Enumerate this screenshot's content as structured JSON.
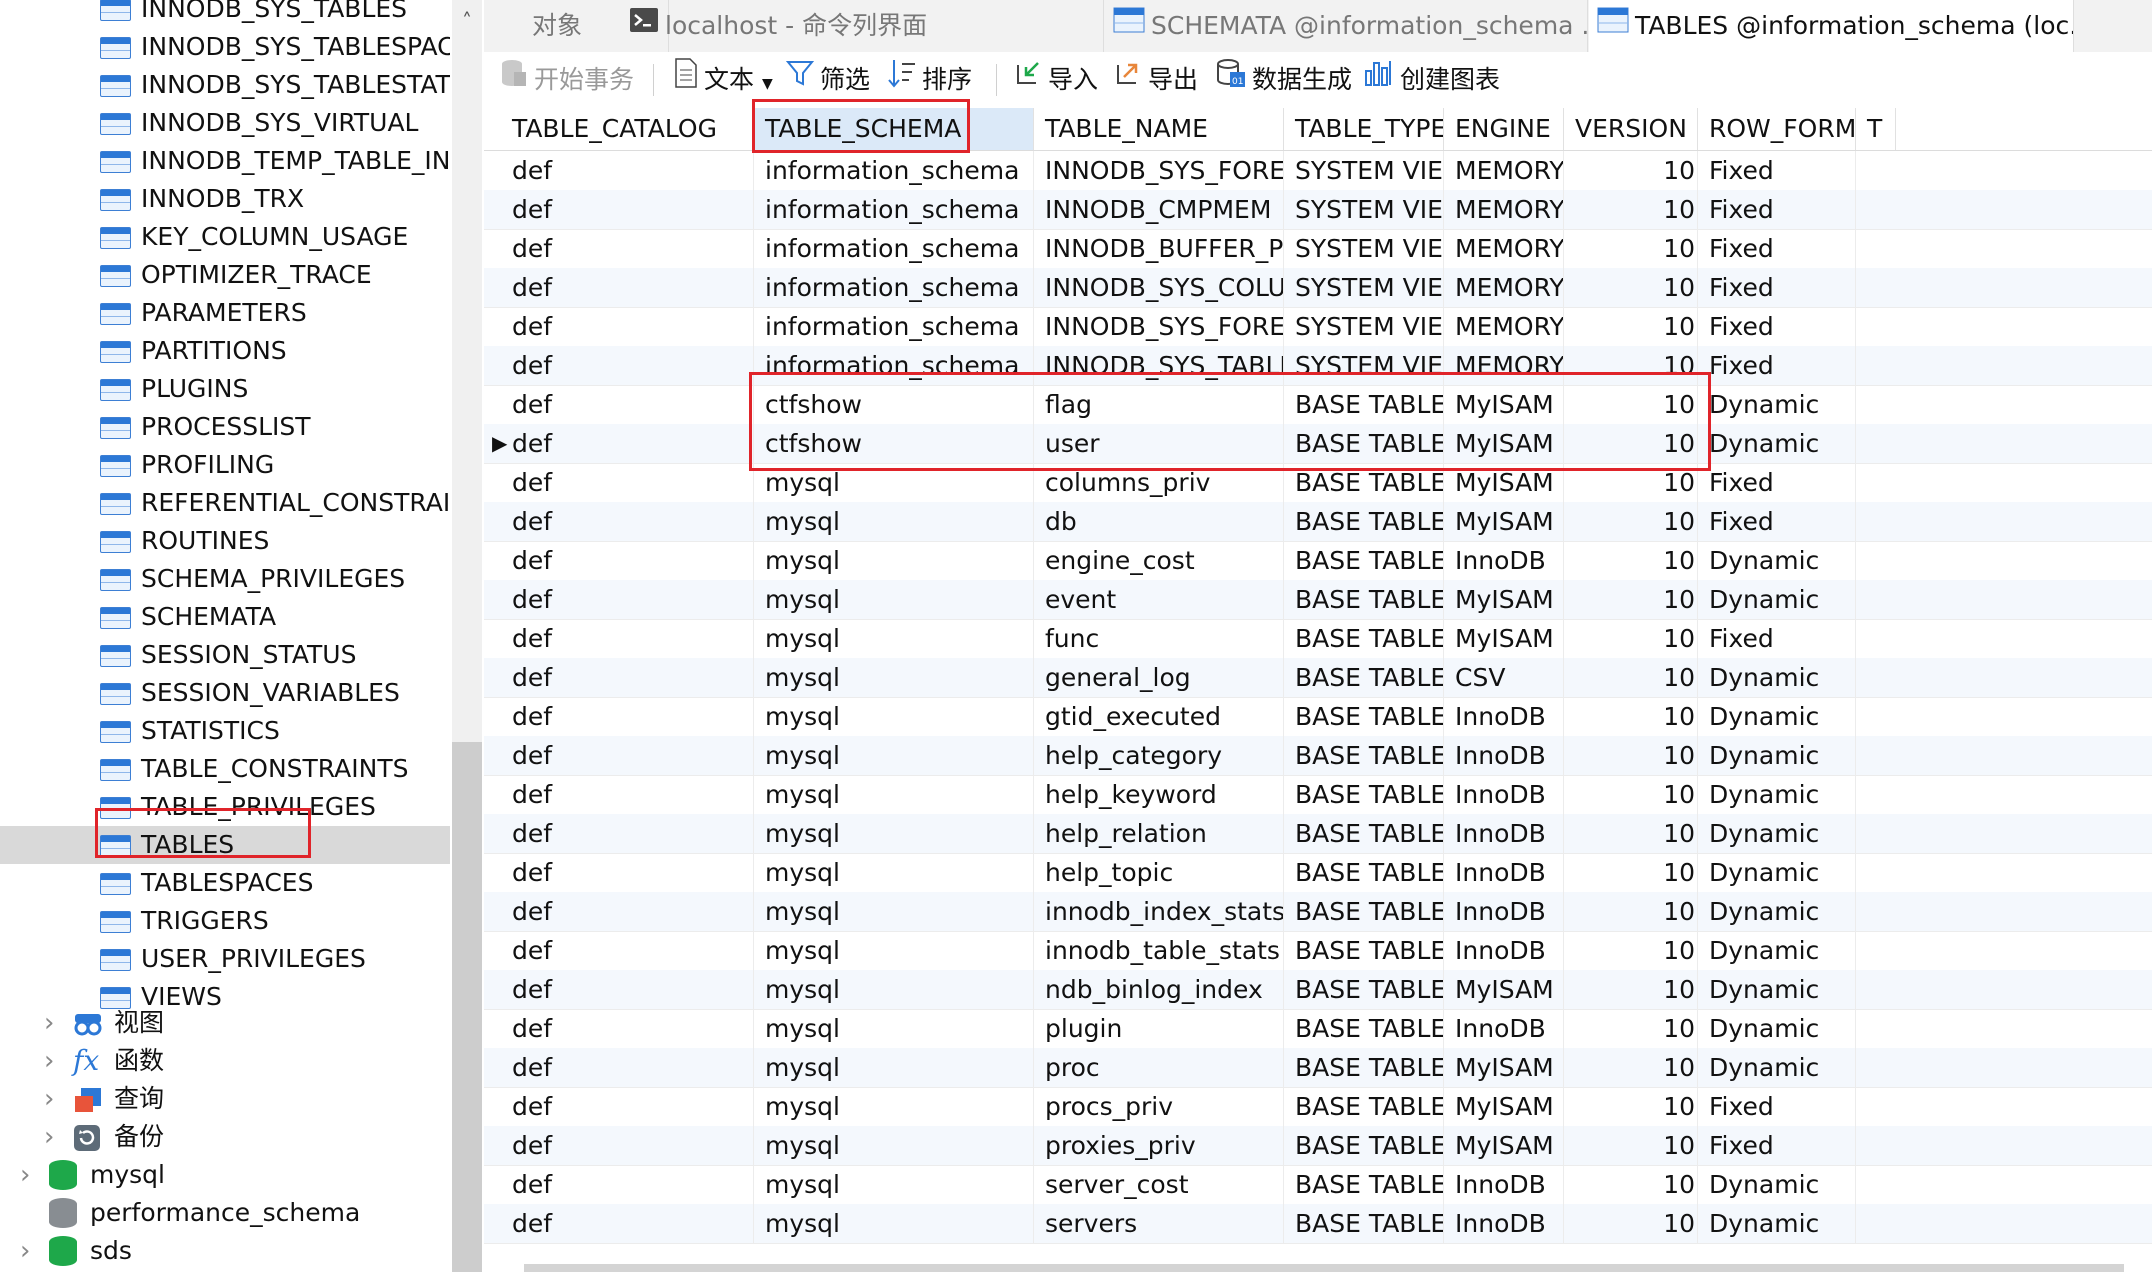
{
  "sidebar": {
    "tables": [
      {
        "label": "INNODB_SYS_TABLES"
      },
      {
        "label": "INNODB_SYS_TABLESPACE"
      },
      {
        "label": "INNODB_SYS_TABLESTATS"
      },
      {
        "label": "INNODB_SYS_VIRTUAL"
      },
      {
        "label": "INNODB_TEMP_TABLE_INF"
      },
      {
        "label": "INNODB_TRX"
      },
      {
        "label": "KEY_COLUMN_USAGE"
      },
      {
        "label": "OPTIMIZER_TRACE"
      },
      {
        "label": "PARAMETERS"
      },
      {
        "label": "PARTITIONS"
      },
      {
        "label": "PLUGINS"
      },
      {
        "label": "PROCESSLIST"
      },
      {
        "label": "PROFILING"
      },
      {
        "label": "REFERENTIAL_CONSTRAIN"
      },
      {
        "label": "ROUTINES"
      },
      {
        "label": "SCHEMA_PRIVILEGES"
      },
      {
        "label": "SCHEMATA"
      },
      {
        "label": "SESSION_STATUS"
      },
      {
        "label": "SESSION_VARIABLES"
      },
      {
        "label": "STATISTICS"
      },
      {
        "label": "TABLE_CONSTRAINTS"
      },
      {
        "label": "TABLE_PRIVILEGES"
      },
      {
        "label": "TABLES",
        "selected": true
      },
      {
        "label": "TABLESPACES"
      },
      {
        "label": "TRIGGERS"
      },
      {
        "label": "USER_PRIVILEGES"
      },
      {
        "label": "VIEWS"
      }
    ],
    "groups": {
      "views": "视图",
      "functions": "函数",
      "queries": "查询",
      "backups": "备份"
    },
    "databases": {
      "mysql": "mysql",
      "performance_schema": "performance_schema",
      "sds": "sds"
    }
  },
  "tabs": {
    "objects": "对象",
    "console": "localhost - 命令列界面",
    "schemata": "SCHEMATA @information_schema ...",
    "tables": "TABLES @information_schema (loc..."
  },
  "toolbar": {
    "begin_transaction": "开始事务",
    "text": "文本",
    "filter": "筛选",
    "sort": "排序",
    "import": "导入",
    "export": "导出",
    "data_generation": "数据生成",
    "create_chart": "创建图表"
  },
  "grid": {
    "columns": [
      "TABLE_CATALOG",
      "TABLE_SCHEMA",
      "TABLE_NAME",
      "TABLE_TYPE",
      "ENGINE",
      "VERSION",
      "ROW_FORMAT",
      "T"
    ],
    "rows": [
      [
        "def",
        "information_schema",
        "INNODB_SYS_FOREIGN_COLS",
        "SYSTEM VIEW",
        "MEMORY",
        "10",
        "Fixed"
      ],
      [
        "def",
        "information_schema",
        "INNODB_CMPMEM",
        "SYSTEM VIEW",
        "MEMORY",
        "10",
        "Fixed"
      ],
      [
        "def",
        "information_schema",
        "INNODB_BUFFER_POOL_STATS",
        "SYSTEM VIEW",
        "MEMORY",
        "10",
        "Fixed"
      ],
      [
        "def",
        "information_schema",
        "INNODB_SYS_COLUMNS",
        "SYSTEM VIEW",
        "MEMORY",
        "10",
        "Fixed"
      ],
      [
        "def",
        "information_schema",
        "INNODB_SYS_FOREIGN",
        "SYSTEM VIEW",
        "MEMORY",
        "10",
        "Fixed"
      ],
      [
        "def",
        "information_schema",
        "INNODB_SYS_TABLESTATS",
        "SYSTEM VIEW",
        "MEMORY",
        "10",
        "Fixed"
      ],
      [
        "def",
        "ctfshow",
        "flag",
        "BASE TABLE",
        "MyISAM",
        "10",
        "Dynamic"
      ],
      [
        "def",
        "ctfshow",
        "user",
        "BASE TABLE",
        "MyISAM",
        "10",
        "Dynamic"
      ],
      [
        "def",
        "mysql",
        "columns_priv",
        "BASE TABLE",
        "MyISAM",
        "10",
        "Fixed"
      ],
      [
        "def",
        "mysql",
        "db",
        "BASE TABLE",
        "MyISAM",
        "10",
        "Fixed"
      ],
      [
        "def",
        "mysql",
        "engine_cost",
        "BASE TABLE",
        "InnoDB",
        "10",
        "Dynamic"
      ],
      [
        "def",
        "mysql",
        "event",
        "BASE TABLE",
        "MyISAM",
        "10",
        "Dynamic"
      ],
      [
        "def",
        "mysql",
        "func",
        "BASE TABLE",
        "MyISAM",
        "10",
        "Fixed"
      ],
      [
        "def",
        "mysql",
        "general_log",
        "BASE TABLE",
        "CSV",
        "10",
        "Dynamic"
      ],
      [
        "def",
        "mysql",
        "gtid_executed",
        "BASE TABLE",
        "InnoDB",
        "10",
        "Dynamic"
      ],
      [
        "def",
        "mysql",
        "help_category",
        "BASE TABLE",
        "InnoDB",
        "10",
        "Dynamic"
      ],
      [
        "def",
        "mysql",
        "help_keyword",
        "BASE TABLE",
        "InnoDB",
        "10",
        "Dynamic"
      ],
      [
        "def",
        "mysql",
        "help_relation",
        "BASE TABLE",
        "InnoDB",
        "10",
        "Dynamic"
      ],
      [
        "def",
        "mysql",
        "help_topic",
        "BASE TABLE",
        "InnoDB",
        "10",
        "Dynamic"
      ],
      [
        "def",
        "mysql",
        "innodb_index_stats",
        "BASE TABLE",
        "InnoDB",
        "10",
        "Dynamic"
      ],
      [
        "def",
        "mysql",
        "innodb_table_stats",
        "BASE TABLE",
        "InnoDB",
        "10",
        "Dynamic"
      ],
      [
        "def",
        "mysql",
        "ndb_binlog_index",
        "BASE TABLE",
        "MyISAM",
        "10",
        "Dynamic"
      ],
      [
        "def",
        "mysql",
        "plugin",
        "BASE TABLE",
        "InnoDB",
        "10",
        "Dynamic"
      ],
      [
        "def",
        "mysql",
        "proc",
        "BASE TABLE",
        "MyISAM",
        "10",
        "Dynamic"
      ],
      [
        "def",
        "mysql",
        "procs_priv",
        "BASE TABLE",
        "MyISAM",
        "10",
        "Fixed"
      ],
      [
        "def",
        "mysql",
        "proxies_priv",
        "BASE TABLE",
        "MyISAM",
        "10",
        "Fixed"
      ],
      [
        "def",
        "mysql",
        "server_cost",
        "BASE TABLE",
        "InnoDB",
        "10",
        "Dynamic"
      ],
      [
        "def",
        "mysql",
        "servers",
        "BASE TABLE",
        "InnoDB",
        "10",
        "Dynamic"
      ]
    ],
    "current_row": 7
  },
  "colors": {
    "highlight_box": "#e0242a",
    "selected_tree_bg": "#d9d9d9",
    "header_highlight": "#dbe9f8",
    "table_icon": "#2c78d6"
  }
}
